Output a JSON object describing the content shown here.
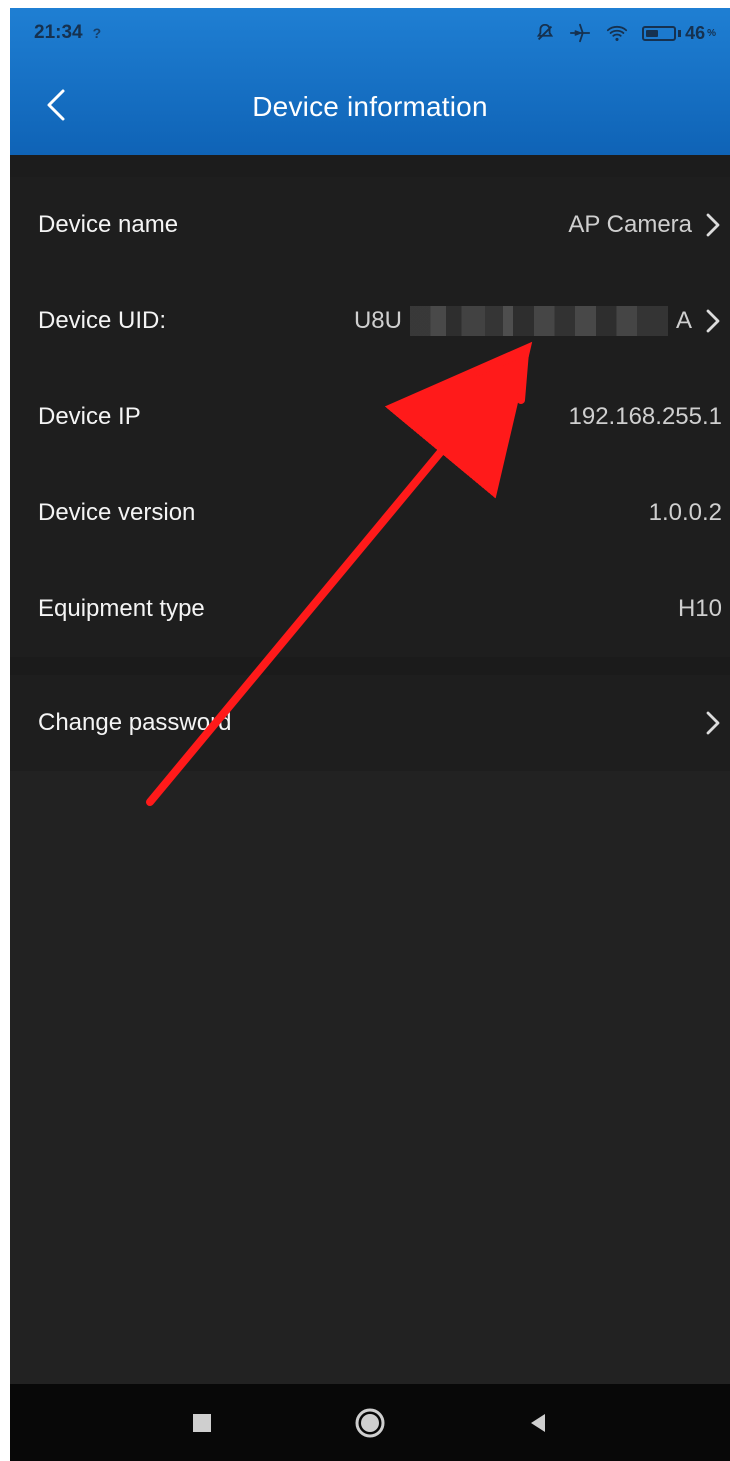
{
  "status_bar": {
    "time": "21:34",
    "battery_level": "46",
    "battery_fraction": 0.46,
    "icons": [
      "mute-icon",
      "airplane-icon",
      "wifi-icon",
      "battery-icon"
    ]
  },
  "header": {
    "title": "Device information"
  },
  "rows": {
    "device_name": {
      "label": "Device name",
      "value": "AP Camera"
    },
    "device_uid": {
      "label": "Device UID:",
      "value_prefix": "U8U",
      "value_suffix": "A"
    },
    "device_ip": {
      "label": "Device IP",
      "value": "192.168.255.1"
    },
    "device_version": {
      "label": "Device version",
      "value": "1.0.0.2"
    },
    "equipment_type": {
      "label": "Equipment type",
      "value": "H10"
    },
    "change_password": {
      "label": "Change password"
    }
  },
  "theme": {
    "header_blue": "#0f63b6",
    "background": "#222222",
    "arrow_red": "#ff1a1a"
  }
}
